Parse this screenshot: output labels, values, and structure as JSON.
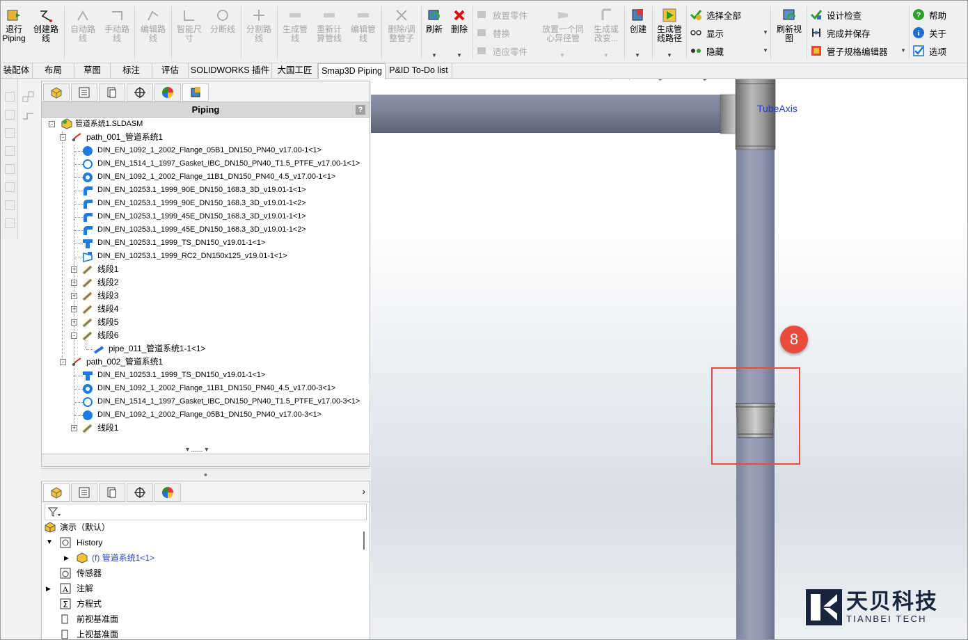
{
  "ribbon": {
    "buttons": [
      {
        "label": "退行\nPiping"
      },
      {
        "label": "创建路\n线"
      },
      {
        "label": "自动路\n线"
      },
      {
        "label": "手动路\n线"
      },
      {
        "label": "编辑路\n线"
      },
      {
        "label": "智能尺\n寸"
      },
      {
        "label": "分断线"
      },
      {
        "label": "分割路\n线"
      },
      {
        "label": "生成管\n线"
      },
      {
        "label": "重新计\n算管线"
      },
      {
        "label": "编辑管\n线"
      },
      {
        "label": "删除/调\n整管子"
      },
      {
        "label": "刷新"
      },
      {
        "label": "删除"
      },
      {
        "label": "放置一个同\n心异径管"
      },
      {
        "label": "生成或\n改变..."
      },
      {
        "label": "创建"
      },
      {
        "label": "生成管\n线路径"
      },
      {
        "label": "刷新视\n图"
      }
    ],
    "small": {
      "place_part": "放置零件",
      "replace": "替换",
      "fit_part": "适应零件",
      "select_all": "选择全部",
      "show": "显示",
      "hide": "隐藏",
      "design_check": "设计检查",
      "finish_save": "完成并保存",
      "spec_editor": "管子规格编辑器",
      "help": "帮助",
      "about": "关于",
      "options": "选项"
    }
  },
  "tabs": [
    "装配体",
    "布局",
    "草图",
    "标注",
    "评估",
    "SOLIDWORKS 插件",
    "大国工匠",
    "Smap3D Piping",
    "P&ID To-Do list"
  ],
  "active_tab": "Smap3D Piping",
  "panel": {
    "title": "Piping",
    "help": "?",
    "tree": {
      "root": "管道系统1.SLDASM",
      "path1": {
        "label": "path_001_管道系统1",
        "parts": [
          "DIN_EN_1092_1_2002_Flange_05B1_DN150_PN40_v17.00-1<1>",
          "DIN_EN_1514_1_1997_Gasket_IBC_DN150_PN40_T1.5_PTFE_v17.00-1<1>",
          "DIN_EN_1092_1_2002_Flange_11B1_DN150_PN40_4.5_v17.00-1<1>",
          "DIN_EN_10253.1_1999_90E_DN150_168.3_3D_v19.01-1<1>",
          "DIN_EN_10253.1_1999_90E_DN150_168.3_3D_v19.01-1<2>",
          "DIN_EN_10253.1_1999_45E_DN150_168.3_3D_v19.01-1<1>",
          "DIN_EN_10253.1_1999_45E_DN150_168.3_3D_v19.01-1<2>",
          "DIN_EN_10253.1_1999_TS_DN150_v19.01-1<1>",
          "DIN_EN_10253.1_1999_RC2_DN150x125_v19.01-1<1>"
        ],
        "segments": [
          "线段1",
          "线段2",
          "线段3",
          "线段4",
          "线段5",
          "线段6"
        ],
        "pipe": "pipe_011_管道系统1-1<1>"
      },
      "path2": {
        "label": "path_002_管道系统1",
        "parts": [
          "DIN_EN_10253.1_1999_TS_DN150_v19.01-1<1>",
          "DIN_EN_1092_1_2002_Flange_11B1_DN150_PN40_4.5_v17.00-3<1>",
          "DIN_EN_1514_1_1997_Gasket_IBC_DN150_PN40_T1.5_PTFE_v17.00-3<1>",
          "DIN_EN_1092_1_2002_Flange_05B1_DN150_PN40_v17.00-3<1>"
        ],
        "segments": [
          "线段1"
        ]
      }
    }
  },
  "lower": {
    "root": "演示（默认）",
    "history": "History",
    "history_item": "(f) 管道系统1<1>",
    "sensors": "传感器",
    "annotations": "注解",
    "equations": "方程式",
    "front_plane": "前视基准面",
    "top_plane": "上视基准面"
  },
  "viewport": {
    "axis_label": "TubeAxis",
    "step_badge": "8"
  },
  "logo": {
    "cn": "天贝科技",
    "en": "TIANBEI TECH"
  },
  "colors": {
    "accent_red": "#e94b3c",
    "tree_blue": "#1e7be0",
    "axis_text": "#1c3fd0",
    "logo_navy": "#18253d"
  }
}
